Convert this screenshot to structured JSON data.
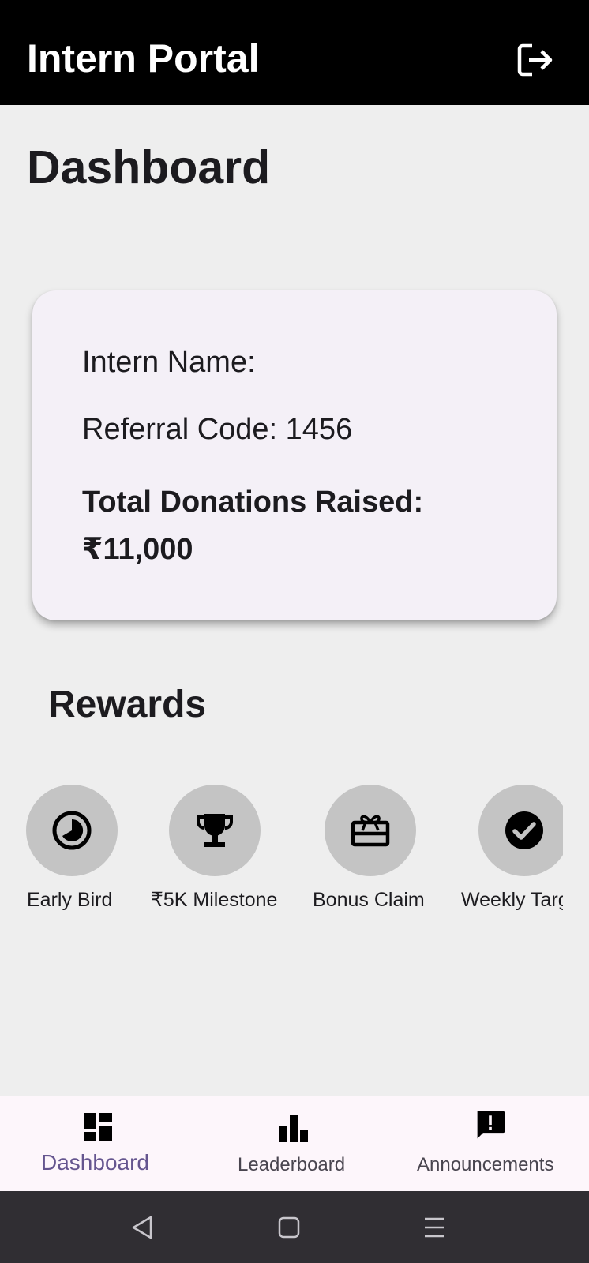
{
  "app_bar": {
    "title": "Intern Portal",
    "logout_icon": "logout-icon"
  },
  "page": {
    "title": "Dashboard"
  },
  "profile_card": {
    "name_text": "Intern Name:",
    "referral_text": "Referral Code: 1456",
    "total_label": "Total Donations Raised:",
    "total_value": "₹11,000"
  },
  "rewards": {
    "title": "Rewards",
    "items": [
      {
        "label": "Early Bird",
        "icon": "early-bird-icon"
      },
      {
        "label": "₹5K Milestone",
        "icon": "trophy-icon"
      },
      {
        "label": "Bonus Claim",
        "icon": "gift-card-icon"
      },
      {
        "label": "Weekly Targ",
        "icon": "check-circle-icon"
      }
    ]
  },
  "bottom_nav": {
    "items": [
      {
        "label": "Dashboard",
        "icon": "dashboard-icon",
        "active": true
      },
      {
        "label": "Leaderboard",
        "icon": "leaderboard-icon",
        "active": false
      },
      {
        "label": "Announcements",
        "icon": "announcement-icon",
        "active": false
      }
    ]
  },
  "colors": {
    "app_bar": "#000000",
    "background": "#eeeeee",
    "card": "#f4f0f7",
    "reward_circle": "#c4c4c4",
    "nav_bar": "#fdf6fb",
    "nav_active": "#65558f",
    "nav_inactive": "#49454f",
    "system_nav": "#302e33"
  }
}
